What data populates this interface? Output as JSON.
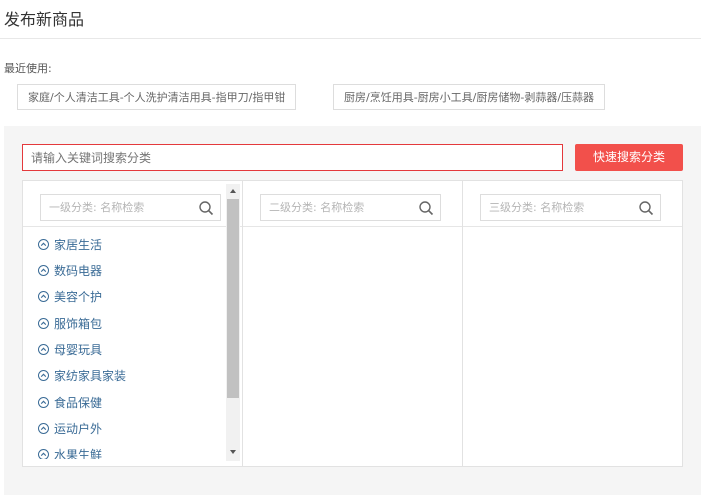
{
  "page": {
    "title": "发布新商品"
  },
  "recent": {
    "label": "最近使用:",
    "items": [
      "家庭/个人清洁工具-个人洗护清洁用具-指甲刀/指甲钳",
      "厨房/烹饪用具-厨房小工具/厨房储物-剥蒜器/压蒜器"
    ]
  },
  "search": {
    "placeholder": "请输入关键词搜索分类",
    "button_label": "快速搜索分类"
  },
  "columns": {
    "level1": {
      "placeholder": "一级分类: 名称检索",
      "items": [
        "家居生活",
        "数码电器",
        "美容个护",
        "服饰箱包",
        "母婴玩具",
        "家纺家具家装",
        "食品保健",
        "运动户外",
        "水果生鲜"
      ]
    },
    "level2": {
      "placeholder": "二级分类: 名称检索"
    },
    "level3": {
      "placeholder": "三级分类: 名称检索"
    }
  },
  "colors": {
    "accent_red": "#f2504b",
    "link_blue": "#3a6b96",
    "panel_bg": "#f5f5f5"
  },
  "icons": {
    "search": "magnifier-icon",
    "category_bullet": "chevron-up-circle-icon"
  }
}
